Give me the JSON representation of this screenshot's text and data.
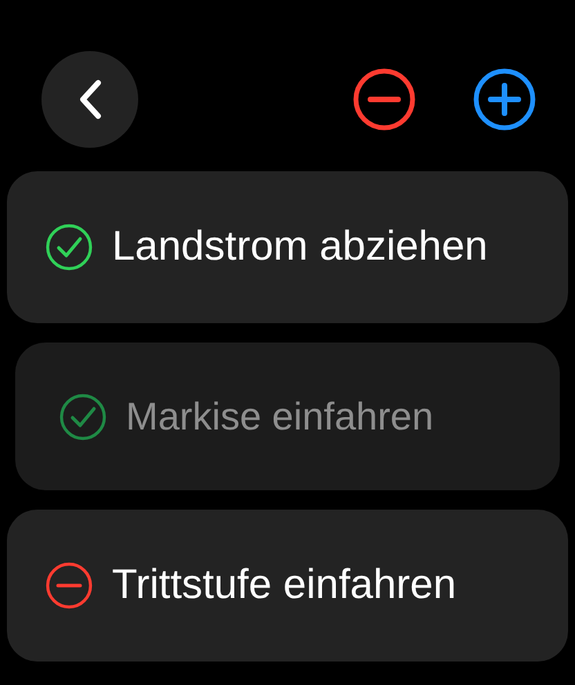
{
  "items": [
    {
      "label": "Landstrom abziehen",
      "kind": "check",
      "dimmed": false
    },
    {
      "label": "Markise einfahren",
      "kind": "check",
      "dimmed": true
    },
    {
      "label": "Trittstufe einfahren",
      "kind": "minus",
      "dimmed": false
    }
  ]
}
